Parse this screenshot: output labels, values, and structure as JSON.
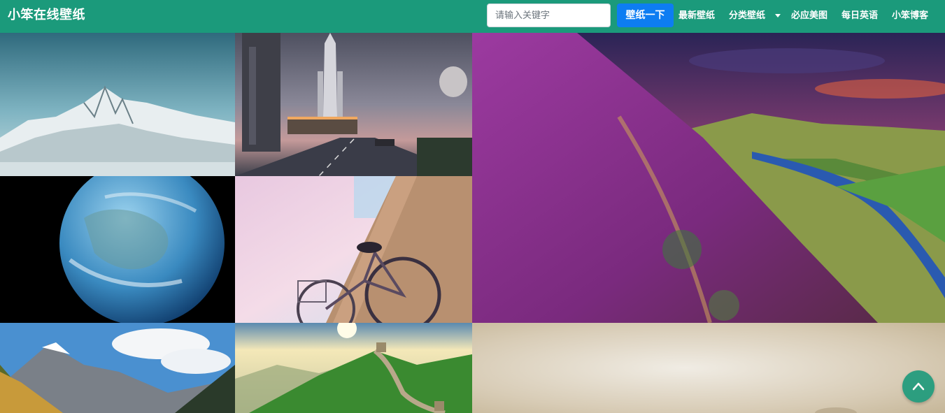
{
  "navbar": {
    "brand": "小笨在线壁纸",
    "search_placeholder": "请输入关键字",
    "search_button": "壁纸一下",
    "links": [
      "最新壁纸",
      "分类壁纸",
      "必应美图",
      "每日英语",
      "小笨博客"
    ]
  },
  "gallery": {
    "tiles": [
      {
        "name": "snow-mountain-wallpaper"
      },
      {
        "name": "space-shuttle-city-wallpaper"
      },
      {
        "name": "heather-hillside-river-wallpaper"
      },
      {
        "name": "earth-from-space-wallpaper"
      },
      {
        "name": "bicycle-wall-wallpaper"
      },
      {
        "name": "alpine-valley-wallpaper"
      },
      {
        "name": "great-wall-wallpaper"
      },
      {
        "name": "blurred-beige-wallpaper"
      }
    ]
  },
  "colors": {
    "navbar": "#1b9a7b",
    "search_button": "#0d7df2"
  },
  "icons": {
    "back_to_top": "chevron-up-icon",
    "dropdown": "caret-down-icon"
  }
}
